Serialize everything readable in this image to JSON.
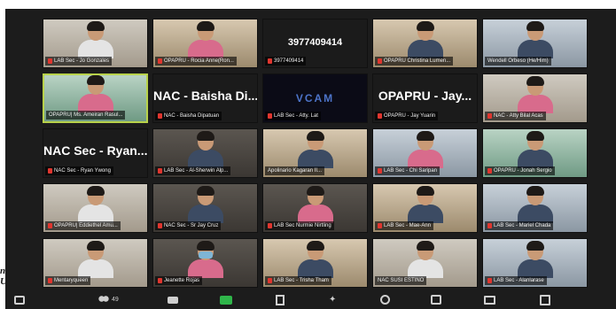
{
  "meeting_id": "3977409414",
  "side_text": [
    "n",
    "U"
  ],
  "tiles": [
    {
      "label": "LAB Sec - Jo Gonzales",
      "type": "video",
      "tone": "light",
      "muted": true
    },
    {
      "label": "OPAPRU - Rocia Anne(Ron...",
      "type": "video",
      "tone": "warm",
      "muted": true
    },
    {
      "label": "3977409414",
      "type": "name",
      "display": "3977409414",
      "num": true,
      "muted": true
    },
    {
      "label": "OPAPRU Christina Lumen...",
      "type": "video",
      "tone": "warm",
      "muted": true
    },
    {
      "label": "Wendell Orbeso (He/Him)",
      "type": "video",
      "tone": "cool",
      "muted": false
    },
    {
      "label": "OPAPRU| Ms. Ameiran Rasul...",
      "type": "video",
      "tone": "green",
      "muted": false,
      "speaking": true
    },
    {
      "label": "NAC - Baisha Dipatuan",
      "type": "name",
      "display": "NAC - Baisha Di...",
      "muted": true
    },
    {
      "label": "LAB Sec - Atty. Lat",
      "type": "vcam",
      "display": "VCAM",
      "muted": true
    },
    {
      "label": "OPAPRU - Jay Yuarin",
      "type": "name",
      "display": "OPAPRU - Jay...",
      "muted": true
    },
    {
      "label": "NAC - Atty Bilal Acas",
      "type": "video",
      "tone": "light",
      "muted": true
    },
    {
      "label": "NAC Sec - Ryan Ywong",
      "type": "name",
      "display": "NAC Sec - Ryan...",
      "muted": true
    },
    {
      "label": "LAB Sec - Al-Sherwin Alp...",
      "type": "video",
      "tone": "dark",
      "muted": true
    },
    {
      "label": "Apolinario Kagaran II...",
      "type": "video",
      "tone": "warm",
      "muted": false
    },
    {
      "label": "LAB Sec - Chi Saripan",
      "type": "video",
      "tone": "cool",
      "muted": true
    },
    {
      "label": "OPAPRU - Jonah Sergio",
      "type": "video",
      "tone": "green",
      "muted": true
    },
    {
      "label": "OPAPRU| Eddiethel Amu...",
      "type": "video",
      "tone": "light",
      "muted": true
    },
    {
      "label": "NAC Sec - Sr Jay Cruz",
      "type": "video",
      "tone": "dark",
      "muted": true
    },
    {
      "label": "LAB Sec Nurmie Nirtling",
      "type": "video",
      "tone": "dark",
      "muted": true
    },
    {
      "label": "LAB Sec - Mae-Ann",
      "type": "video",
      "tone": "warm",
      "muted": true
    },
    {
      "label": "LAB Sec - Mariel Chada",
      "type": "video",
      "tone": "cool",
      "muted": true
    },
    {
      "label": "Mentaryqueen",
      "type": "video",
      "tone": "light",
      "muted": true
    },
    {
      "label": "Jeanette Rojas",
      "type": "video",
      "tone": "dark",
      "muted": true,
      "mask": true
    },
    {
      "label": "LAB Sec - Trisha Tham",
      "type": "video",
      "tone": "warm",
      "muted": true
    },
    {
      "label": "NAC SUSI ESTINO",
      "type": "video",
      "tone": "light",
      "muted": false
    },
    {
      "label": "LAB Sec - Alanlarase",
      "type": "video",
      "tone": "cool",
      "muted": true
    }
  ],
  "toolbar": {
    "participants_count": "49"
  }
}
